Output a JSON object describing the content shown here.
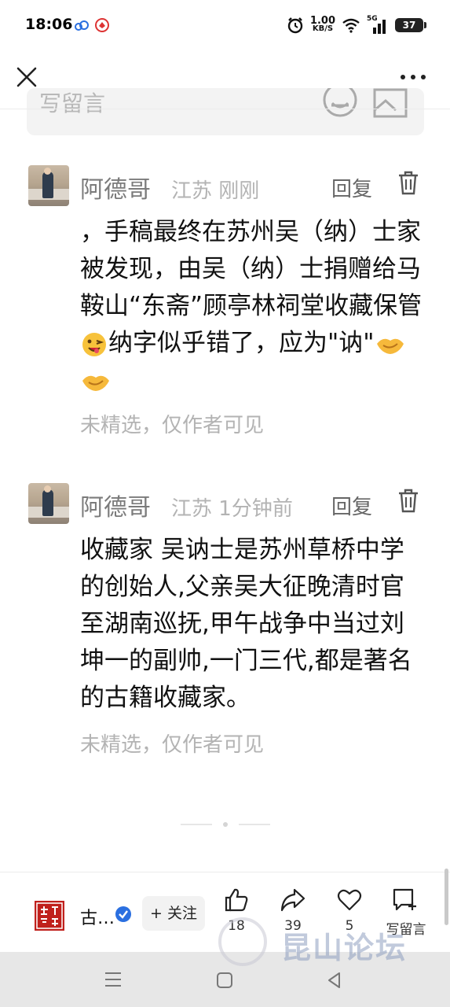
{
  "status_bar": {
    "time": "18:06",
    "speed_value": "1.00",
    "speed_unit": "KB/S",
    "network": "5G",
    "battery": "37"
  },
  "comment_input": {
    "placeholder": "写留言"
  },
  "comments": [
    {
      "username": "阿德哥",
      "location": "江苏",
      "time": "刚刚",
      "reply_label": "回复",
      "text_part1": "，手稿最终在苏州吴（纳）士家被发现，由吴（纳）士捐赠给马鞍山“东斋”顾亭林祠堂收藏保管",
      "text_part2": "纳字似乎错了，应为\"讷\"",
      "status": "未精选，仅作者可见"
    },
    {
      "username": "阿德哥",
      "location": "江苏",
      "time": "1分钟前",
      "reply_label": "回复",
      "text": "收藏家 吴讷士是苏州草桥中学的创始人,父亲吴大征晚清时官至湖南巡抚,甲午战争中当过刘坤一的副帅,一门三代,都是著名的古籍收藏家。",
      "status": "未精选，仅作者可见"
    }
  ],
  "bottom_bar": {
    "account_logo_text": "古籍保护",
    "account_name": "古…",
    "follow_label": "+ 关注",
    "like_count": "18",
    "share_count": "39",
    "favorite_count": "5",
    "write_comment_label": "写留言"
  },
  "watermark": {
    "text": "昆山论坛"
  },
  "icons": {
    "close": "close-icon",
    "more": "more-icon",
    "emoji": "emoji-icon",
    "image": "image-icon",
    "trash": "trash-icon",
    "like": "thumbs-up-icon",
    "share": "share-icon",
    "favorite": "heart-icon",
    "comment": "comment-add-icon"
  },
  "colors": {
    "brand_red": "#c0201c",
    "verified_blue": "#2a6fe0",
    "muted_text": "#b3b3b3"
  }
}
